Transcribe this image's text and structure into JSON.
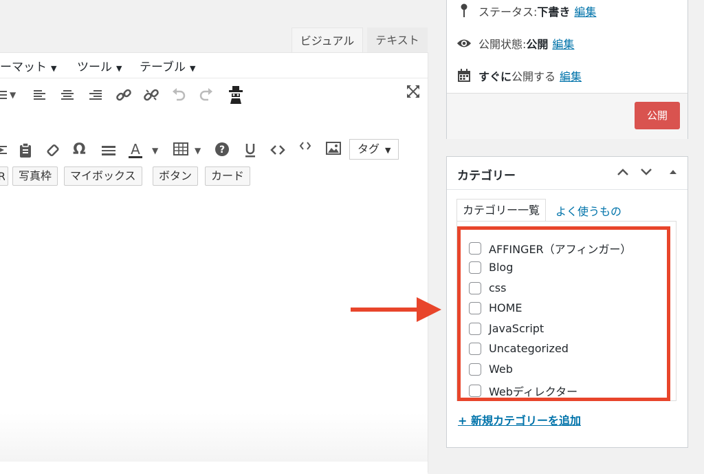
{
  "editor": {
    "tabs": {
      "visual": "ビジュアル",
      "text": "テキスト"
    },
    "menu": {
      "format": "ーマット",
      "tools": "ツール",
      "table": "テーブル"
    },
    "tag_select": "タグ",
    "quicktags": [
      "写真枠",
      "マイボックス",
      "ボタン",
      "カード"
    ],
    "toolbar_icons": {
      "row1": [
        "align-left-icon",
        "align-center-icon",
        "align-right-icon",
        "link-icon",
        "unlink-icon",
        "undo-icon",
        "redo-icon",
        "spy-icon"
      ],
      "row2": [
        "paste-icon",
        "clipboard-icon",
        "eraser-icon",
        "omega-icon",
        "hr-icon",
        "text-color-icon",
        "table-icon",
        "help-icon",
        "underline-icon",
        "code-icon",
        "code-small-icon",
        "image-icon"
      ]
    }
  },
  "publish": {
    "status_label": "ステータス: ",
    "status_value": "下書き",
    "visibility_label": "公開状態: ",
    "visibility_value": "公開",
    "schedule_value": "すぐに",
    "schedule_label": "公開する",
    "edit_link": "編集",
    "publish_button": "公開"
  },
  "categories": {
    "title": "カテゴリー",
    "tab_all": "カテゴリー一覧",
    "tab_popular": "よく使うもの",
    "items": [
      "AFFINGER（アフィンガー）",
      "Blog",
      "css",
      "HOME",
      "JavaScript",
      "Uncategorized",
      "Web",
      "Webディレクター"
    ],
    "add_new": "+ 新規カテゴリーを追加"
  },
  "colors": {
    "accent_link": "#0073aa",
    "publish_button": "#d9534f",
    "highlight": "#e8452b"
  }
}
